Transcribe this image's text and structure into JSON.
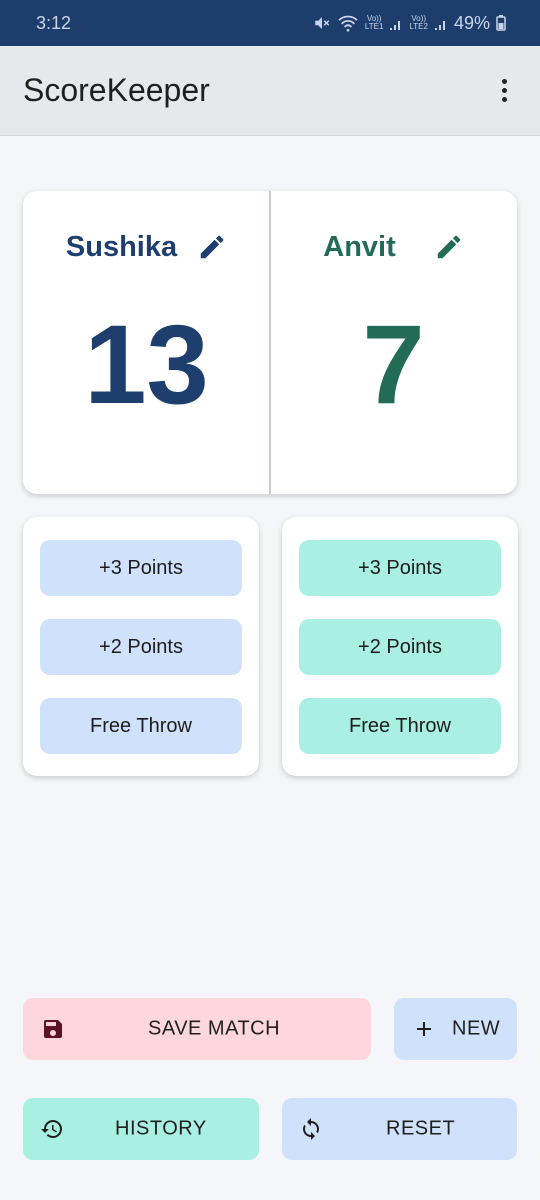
{
  "status_bar": {
    "time": "3:12",
    "lte1": "Vo))\nLTE1",
    "lte2": "Vo))\nLTE2",
    "battery": "49%"
  },
  "app_bar": {
    "title": "ScoreKeeper",
    "menu_icon": "more-vert-icon"
  },
  "teams": [
    {
      "name": "Sushika",
      "score": "13",
      "color": "#1e3f6e",
      "button_color": "#d0e2fb"
    },
    {
      "name": "Anvit",
      "score": "7",
      "color": "#226b57",
      "button_color": "#a9f0e2"
    }
  ],
  "point_buttons": [
    "+3 Points",
    "+2 Points",
    "Free Throw"
  ],
  "actions": {
    "save": {
      "label": "SAVE MATCH",
      "icon": "save-icon",
      "color": "#fdd7dd"
    },
    "new": {
      "label": "NEW",
      "icon": "plus-icon",
      "color": "#d0e2fb"
    },
    "history": {
      "label": "HISTORY",
      "icon": "history-icon",
      "color": "#a9f0e2"
    },
    "reset": {
      "label": "RESET",
      "icon": "sync-icon",
      "color": "#d0e2fb"
    }
  }
}
